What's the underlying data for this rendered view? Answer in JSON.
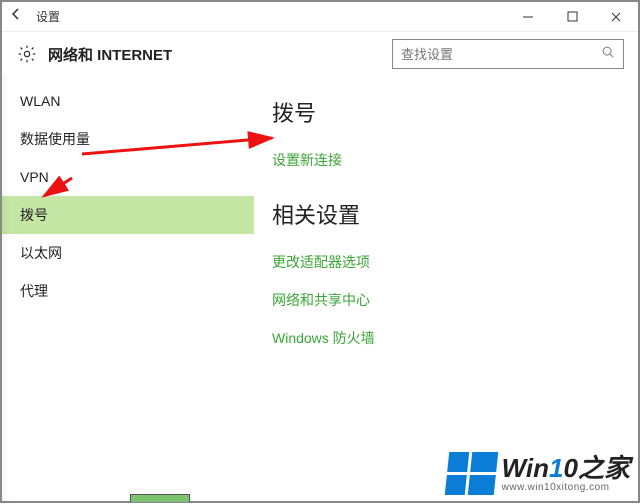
{
  "titlebar": {
    "title": "设置"
  },
  "header": {
    "title": "网络和 INTERNET",
    "search_placeholder": "查找设置"
  },
  "sidebar": {
    "items": [
      {
        "label": "WLAN",
        "selected": false
      },
      {
        "label": "数据使用量",
        "selected": false
      },
      {
        "label": "VPN",
        "selected": false
      },
      {
        "label": "拨号",
        "selected": true
      },
      {
        "label": "以太网",
        "selected": false
      },
      {
        "label": "代理",
        "selected": false
      }
    ]
  },
  "main": {
    "section1_title": "拨号",
    "link_new_conn": "设置新连接",
    "section2_title": "相关设置",
    "link_adapter": "更改适配器选项",
    "link_sharing": "网络和共享中心",
    "link_firewall": "Windows 防火墙"
  },
  "watermark": {
    "brand_prefix": "Win",
    "brand_accent": "1",
    "brand_suffix_white": "0",
    "brand_tail": "之家",
    "url": "www.win10xitong.com"
  }
}
